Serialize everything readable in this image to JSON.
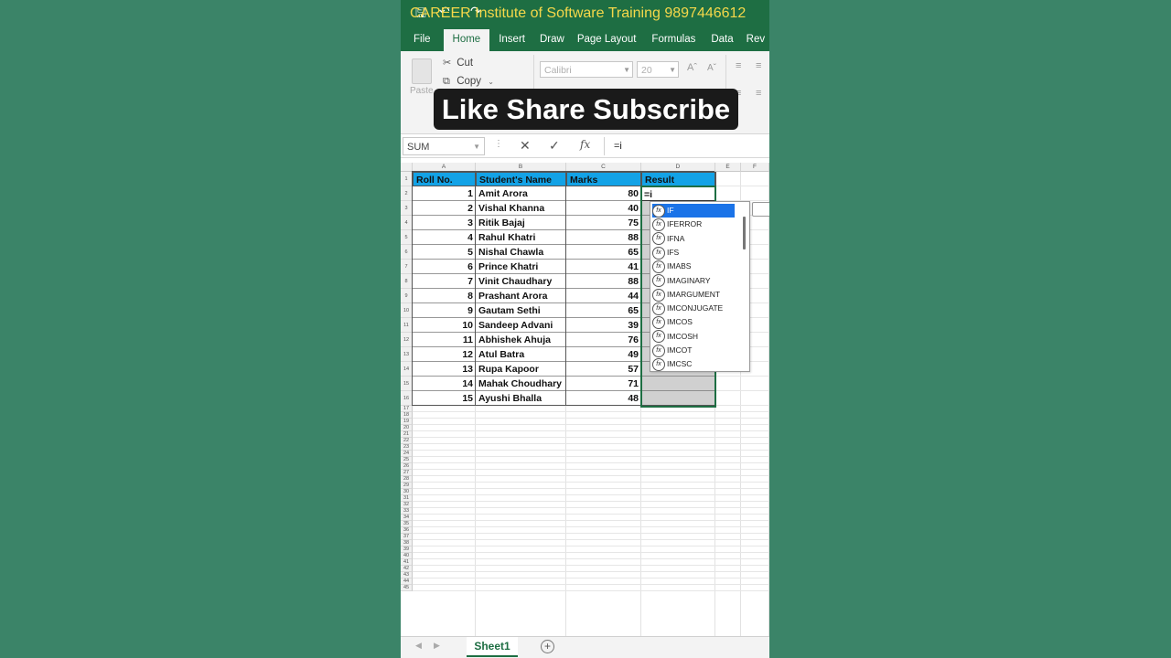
{
  "titlebar": {
    "title": "CAREER Institute of Software Training 9897446612",
    "qat_icons": [
      "save-icon",
      "undo-icon",
      "redo-icon"
    ]
  },
  "tabs": [
    "File",
    "Home",
    "Insert",
    "Draw",
    "Page Layout",
    "Formulas",
    "Data",
    "Rev"
  ],
  "active_tab": "Home",
  "ribbon": {
    "paste_label": "Paste",
    "cut_label": "Cut",
    "copy_label": "Copy",
    "font_name": "Calibri",
    "font_size": "20"
  },
  "overlay_text": "Like Share Subscribe",
  "formula_bar": {
    "name_box": "SUM",
    "formula": "=i"
  },
  "columns": [
    "A",
    "B",
    "C",
    "D",
    "E",
    "F"
  ],
  "headers": [
    "Roll No.",
    "Student's Name",
    "Marks",
    "Result"
  ],
  "rows": [
    {
      "roll": "1",
      "name": "Amit Arora",
      "marks": "80"
    },
    {
      "roll": "2",
      "name": "Vishal Khanna",
      "marks": "40"
    },
    {
      "roll": "3",
      "name": "Ritik Bajaj",
      "marks": "75"
    },
    {
      "roll": "4",
      "name": "Rahul Khatri",
      "marks": "88"
    },
    {
      "roll": "5",
      "name": "Nishal Chawla",
      "marks": "65"
    },
    {
      "roll": "6",
      "name": "Prince Khatri",
      "marks": "41"
    },
    {
      "roll": "7",
      "name": "Vinit Chaudhary",
      "marks": "88"
    },
    {
      "roll": "8",
      "name": "Prashant Arora",
      "marks": "44"
    },
    {
      "roll": "9",
      "name": "Gautam Sethi",
      "marks": "65"
    },
    {
      "roll": "10",
      "name": "Sandeep Advani",
      "marks": "39"
    },
    {
      "roll": "11",
      "name": "Abhishek Ahuja",
      "marks": "76"
    },
    {
      "roll": "12",
      "name": "Atul Batra",
      "marks": "49"
    },
    {
      "roll": "13",
      "name": "Rupa Kapoor",
      "marks": "57"
    },
    {
      "roll": "14",
      "name": "Mahak Choudhary",
      "marks": "71"
    },
    {
      "roll": "15",
      "name": "Ayushi Bhalla",
      "marks": "48"
    }
  ],
  "editing_cell_text": "=i",
  "autocomplete": [
    "IF",
    "IFERROR",
    "IFNA",
    "IFS",
    "IMABS",
    "IMAGINARY",
    "IMARGUMENT",
    "IMCONJUGATE",
    "IMCOS",
    "IMCOSH",
    "IMCOT",
    "IMCSC"
  ],
  "autocomplete_selected": "IF",
  "row_numbers": [
    "1",
    "2",
    "3",
    "4",
    "5",
    "6",
    "7",
    "8",
    "9",
    "10",
    "11",
    "12",
    "13",
    "14",
    "15",
    "16",
    "17",
    "18",
    "19",
    "20",
    "21",
    "22",
    "23",
    "24",
    "25",
    "26",
    "27",
    "28",
    "29",
    "30",
    "31",
    "32",
    "33",
    "34",
    "35",
    "36",
    "37",
    "38",
    "39",
    "40",
    "41",
    "42",
    "43",
    "44",
    "45"
  ],
  "sheet_tab": "Sheet1",
  "add_sheet_icon": "plus-circle-icon"
}
